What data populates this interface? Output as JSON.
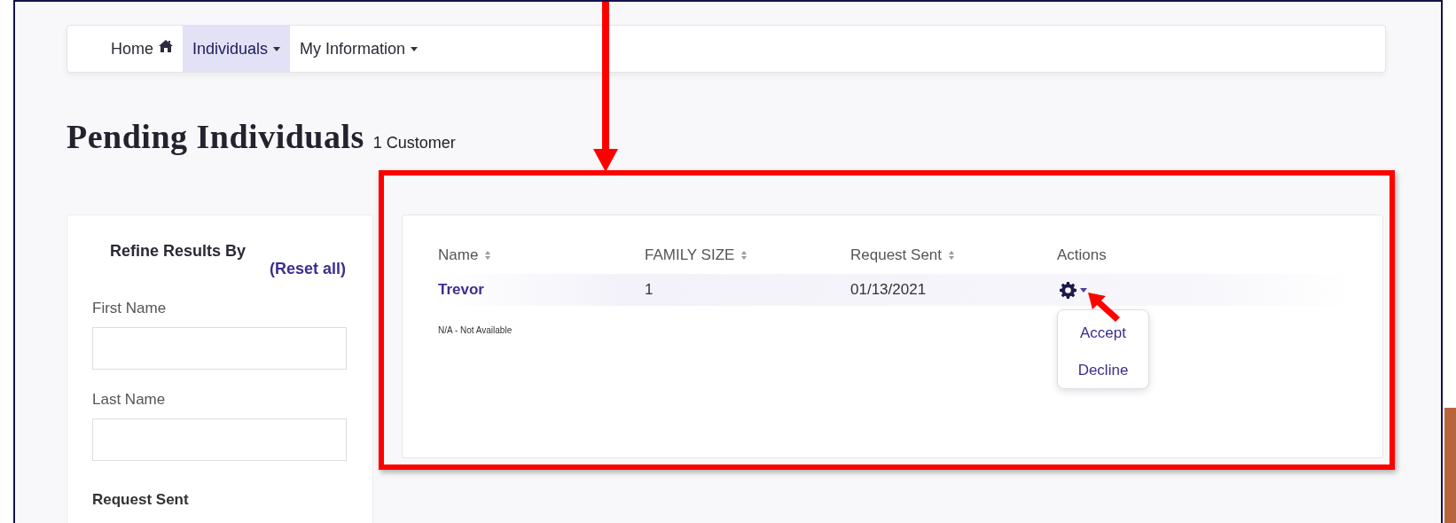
{
  "nav": [
    {
      "label": "Home",
      "kind": "icon",
      "selected": false
    },
    {
      "label": "Individuals",
      "kind": "dropdown",
      "selected": true
    },
    {
      "label": "My Information",
      "kind": "dropdown",
      "selected": false
    }
  ],
  "page": {
    "title": "Pending Individuals",
    "count": "1 Customer"
  },
  "filters": {
    "title": "Refine Results By",
    "reset": "(Reset all)",
    "fields": [
      {
        "label": "First Name",
        "kind": "text"
      },
      {
        "label": "Last Name",
        "kind": "text"
      },
      {
        "label": "Request Sent",
        "kind": "heading"
      }
    ]
  },
  "table": {
    "columns": [
      {
        "label": "Name",
        "sortable": true
      },
      {
        "label": "FAMILY SIZE",
        "sortable": true
      },
      {
        "label": "Request Sent",
        "sortable": true
      },
      {
        "label": "Actions",
        "sortable": false
      }
    ],
    "rows": [
      {
        "name": "Trevor",
        "family_size": "1",
        "request_sent": "01/13/2021",
        "menu": {
          "expanded": true,
          "items": [
            "Accept",
            "Decline"
          ]
        }
      }
    ],
    "footnote": "N/A - Not Available"
  }
}
